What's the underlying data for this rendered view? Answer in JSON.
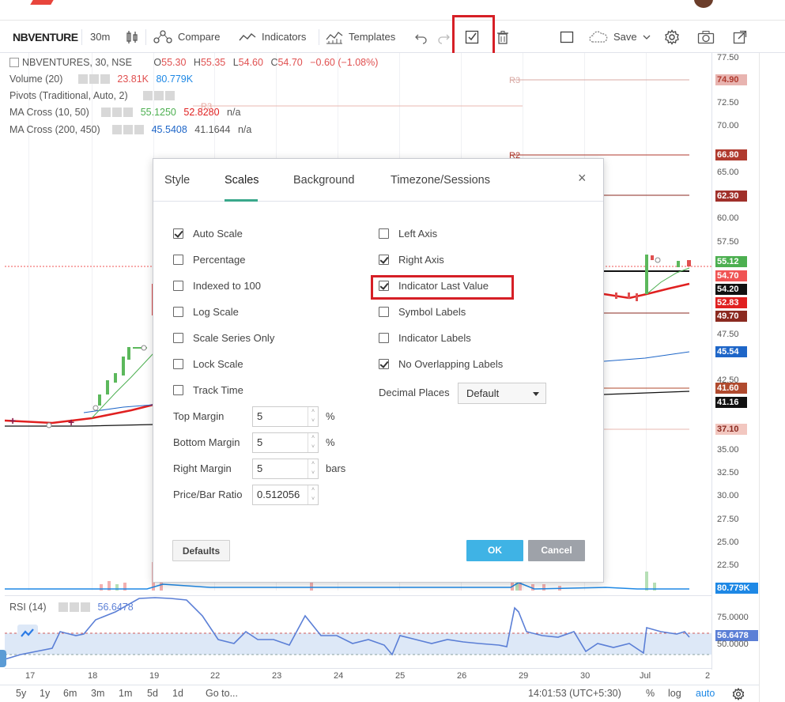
{
  "toolbar": {
    "symbol": "NBVENTURE",
    "interval": "30m",
    "compare": "Compare",
    "indicators": "Indicators",
    "templates": "Templates",
    "save": "Save"
  },
  "legend": {
    "main": {
      "symbol": "NBVENTURES, 30, NSE",
      "o": "O",
      "o_val": "55.30",
      "h": "H",
      "h_val": "55.35",
      "l": "L",
      "l_val": "54.60",
      "c": "C",
      "c_val": "54.70",
      "change": "−0.60 (−1.08%)"
    },
    "volume": {
      "label": "Volume (20)",
      "v1": "23.81K",
      "v2": "80.779K"
    },
    "pivots": {
      "label": "Pivots (Traditional, Auto, 2)"
    },
    "ma1": {
      "label": "MA Cross (10, 50)",
      "v1": "55.1250",
      "v2": "52.8280",
      "v3": "n/a"
    },
    "ma2": {
      "label": "MA Cross (200, 450)",
      "v1": "45.5408",
      "v2": "41.1644",
      "v3": "n/a"
    }
  },
  "pivot_labels": {
    "r3_left": "R3",
    "r3_right": "R3",
    "r2": "R2"
  },
  "price_axis": {
    "ticks": [
      "77.50",
      "72.50",
      "70.00",
      "65.00",
      "60.00",
      "57.50",
      "47.50",
      "42.50",
      "35.00",
      "32.50",
      "30.00",
      "27.50",
      "25.00",
      "22.50"
    ],
    "tags": [
      {
        "text": "74.90",
        "color": "#e8b4b0",
        "fg": "#b03a2e"
      },
      {
        "text": "66.80",
        "color": "#b03a2e",
        "fg": "#ffffff"
      },
      {
        "text": "62.30",
        "color": "#a0302a",
        "fg": "#ffffff"
      },
      {
        "text": "55.12",
        "color": "#4caf50",
        "fg": "#ffffff"
      },
      {
        "text": "54.70",
        "color": "#f05454",
        "fg": "#ffffff"
      },
      {
        "text": "54.20",
        "color": "#111111",
        "fg": "#ffffff"
      },
      {
        "text": "52.83",
        "color": "#e02020",
        "fg": "#ffffff"
      },
      {
        "text": "49.70",
        "color": "#8b2a20",
        "fg": "#ffffff"
      },
      {
        "text": "45.54",
        "color": "#1e66c8",
        "fg": "#ffffff"
      },
      {
        "text": "41.60",
        "color": "#b04a2e",
        "fg": "#ffffff"
      },
      {
        "text": "41.16",
        "color": "#111111",
        "fg": "#ffffff"
      },
      {
        "text": "37.10",
        "color": "#f2c7c0",
        "fg": "#8b2a20"
      },
      {
        "text": "80.779K",
        "color": "#1e88e5",
        "fg": "#ffffff"
      }
    ]
  },
  "rsi": {
    "label": "RSI (14)",
    "value": "56.6478",
    "axis_ticks": [
      "75.0000",
      "50.0000"
    ],
    "tag": "56.6478"
  },
  "time_axis": [
    "17",
    "18",
    "19",
    "22",
    "23",
    "24",
    "25",
    "26",
    "29",
    "30",
    "Jul",
    "2"
  ],
  "bottom_bar": {
    "ranges": [
      "5y",
      "1y",
      "6m",
      "3m",
      "1m",
      "5d",
      "1d"
    ],
    "goto": "Go to...",
    "clock": "14:01:53 (UTC+5:30)",
    "percent": "%",
    "log": "log",
    "auto": "auto"
  },
  "dialog": {
    "tabs": [
      "Style",
      "Scales",
      "Background",
      "Timezone/Sessions"
    ],
    "active_tab": "Scales",
    "close": "×",
    "left_options": [
      {
        "label": "Auto Scale",
        "checked": true
      },
      {
        "label": "Percentage",
        "checked": false
      },
      {
        "label": "Indexed to 100",
        "checked": false
      },
      {
        "label": "Log Scale",
        "checked": false
      },
      {
        "label": "Scale Series Only",
        "checked": false
      },
      {
        "label": "Lock Scale",
        "checked": false
      },
      {
        "label": "Track Time",
        "checked": false
      }
    ],
    "right_options": [
      {
        "label": "Left Axis",
        "checked": false
      },
      {
        "label": "Right Axis",
        "checked": true
      },
      {
        "label": "Indicator Last Value",
        "checked": true
      },
      {
        "label": "Symbol Labels",
        "checked": false
      },
      {
        "label": "Indicator Labels",
        "checked": false
      },
      {
        "label": "No Overlapping Labels",
        "checked": true
      }
    ],
    "fields": [
      {
        "label": "Top Margin",
        "value": "5",
        "unit": "%"
      },
      {
        "label": "Bottom Margin",
        "value": "5",
        "unit": "%"
      },
      {
        "label": "Right Margin",
        "value": "5",
        "unit": "bars"
      },
      {
        "label": "Price/Bar Ratio",
        "value": "0.512056",
        "unit": ""
      }
    ],
    "decimal_label": "Decimal Places",
    "decimal_value": "Default",
    "defaults_button": "Defaults",
    "ok_button": "OK",
    "cancel_button": "Cancel"
  },
  "colors": {
    "highlight": "#d61f26",
    "accent_tab": "#3aa88b",
    "ok": "#3fb3e5",
    "cancel": "#9ea2a9"
  }
}
